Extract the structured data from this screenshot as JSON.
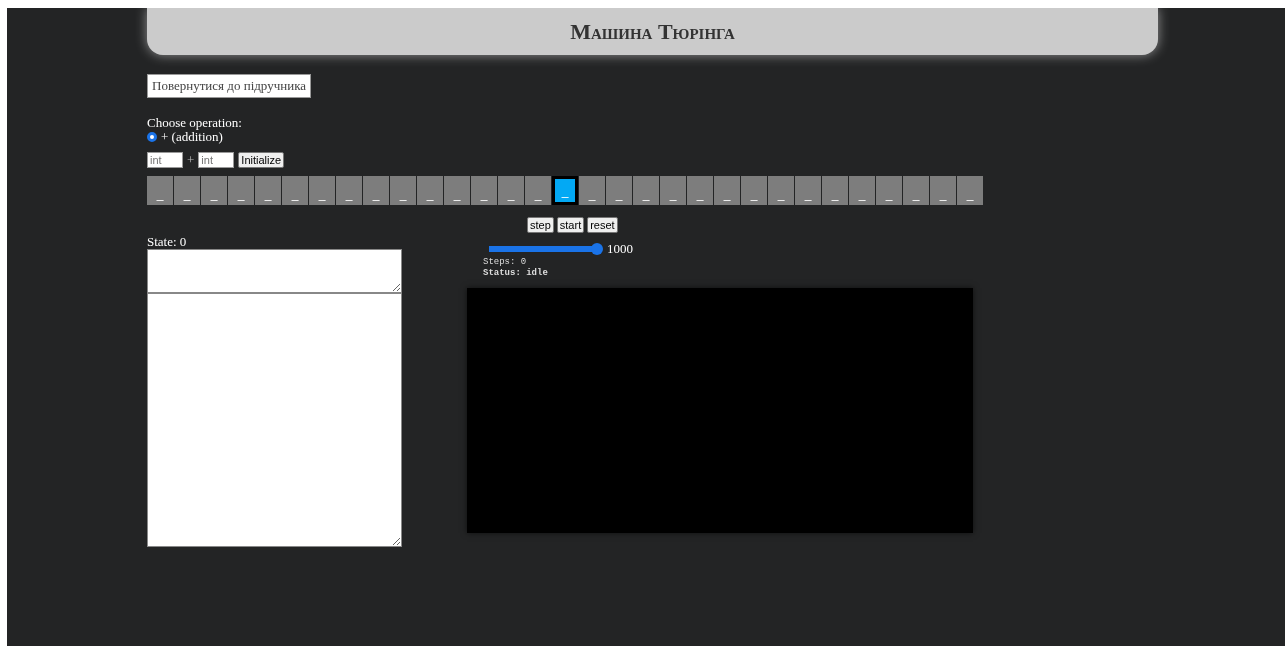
{
  "header": {
    "title": "Машина Тюрінга"
  },
  "back_button": {
    "label": "Повернутися до підручника"
  },
  "operation": {
    "label": "Choose operation:",
    "options": [
      {
        "label": "+ (addition)",
        "selected": true
      }
    ]
  },
  "inputs": {
    "first": {
      "placeholder": "int"
    },
    "operator": "+",
    "second": {
      "placeholder": "int"
    },
    "button": "Initialize"
  },
  "tape": {
    "cells": [
      {
        "symbol": "_",
        "selected": false
      },
      {
        "symbol": "_",
        "selected": false
      },
      {
        "symbol": "_",
        "selected": false
      },
      {
        "symbol": "_",
        "selected": false
      },
      {
        "symbol": "_",
        "selected": false
      },
      {
        "symbol": "_",
        "selected": false
      },
      {
        "symbol": "_",
        "selected": false
      },
      {
        "symbol": "_",
        "selected": false
      },
      {
        "symbol": "_",
        "selected": false
      },
      {
        "symbol": "_",
        "selected": false
      },
      {
        "symbol": "_",
        "selected": false
      },
      {
        "symbol": "_",
        "selected": false
      },
      {
        "symbol": "_",
        "selected": false
      },
      {
        "symbol": "_",
        "selected": false
      },
      {
        "symbol": "_",
        "selected": false
      },
      {
        "symbol": "_",
        "selected": true
      },
      {
        "symbol": "_",
        "selected": false
      },
      {
        "symbol": "_",
        "selected": false
      },
      {
        "symbol": "_",
        "selected": false
      },
      {
        "symbol": "_",
        "selected": false
      },
      {
        "symbol": "_",
        "selected": false
      },
      {
        "symbol": "_",
        "selected": false
      },
      {
        "symbol": "_",
        "selected": false
      },
      {
        "symbol": "_",
        "selected": false
      },
      {
        "symbol": "_",
        "selected": false
      },
      {
        "symbol": "_",
        "selected": false
      },
      {
        "symbol": "_",
        "selected": false
      },
      {
        "symbol": "_",
        "selected": false
      },
      {
        "symbol": "_",
        "selected": false
      },
      {
        "symbol": "_",
        "selected": false
      },
      {
        "symbol": "_",
        "selected": false
      }
    ]
  },
  "controls": {
    "buttons": [
      "step",
      "start",
      "reset"
    ],
    "speed": {
      "level": 1,
      "reading": "1000"
    },
    "steps": "Steps: 0",
    "status": "Status: idle"
  },
  "state": {
    "label": "State: 0"
  }
}
